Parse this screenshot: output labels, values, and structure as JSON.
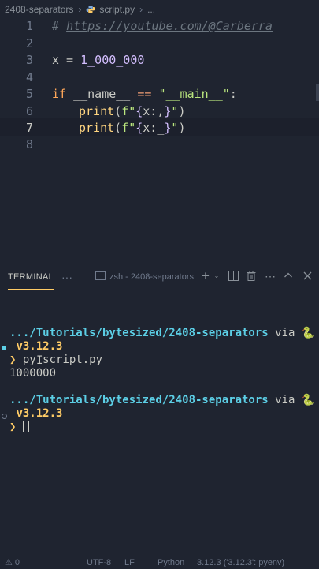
{
  "breadcrumb": {
    "folder": "2408-separators",
    "file": "script.py",
    "ellipsis": "..."
  },
  "editor": {
    "line_numbers": [
      "1",
      "2",
      "3",
      "4",
      "5",
      "6",
      "7",
      "8"
    ],
    "active_line": "7",
    "lines": {
      "l1": {
        "hash": "# ",
        "url": "https://youtube.com/@Carberra"
      },
      "l3": {
        "var": "x",
        "eq": " = ",
        "num": "1_000_000"
      },
      "l5": {
        "kw": "if",
        "name": " __name__ ",
        "op": "==",
        "str": " \"__main__\"",
        "colon": ":"
      },
      "l6": {
        "fn": "print",
        "open": "(",
        "fpre": "f\"",
        "lb": "{",
        "expr": "x:,",
        "rb": "}",
        "fpost": "\"",
        "close": ")"
      },
      "l7": {
        "fn": "print",
        "open": "(",
        "fpre": "f\"",
        "lb": "{",
        "expr": "x:_",
        "rb": "}",
        "fpost": "\"",
        "close": ")"
      }
    }
  },
  "panel": {
    "tab_terminal": "TERMINAL",
    "more": "···",
    "terminal_name": "zsh - 2408-separators"
  },
  "terminal": {
    "path1": ".../Tutorials/bytesized/2408-separators",
    "via1": " via ",
    "snake1": "🐍",
    "version1": "v3.12.3",
    "prompt1": "❯",
    "command1": " py script.py",
    "output1": "1000000",
    "path2": ".../Tutorials/bytesized/2408-separators",
    "via2": " via ",
    "snake2": "🐍",
    "version2": "v3.12.3",
    "prompt2": "❯"
  },
  "statusbar": {
    "problems": "⚠ 0",
    "encoding": "UTF-8",
    "eol": "LF",
    "language": "Python",
    "interpreter": "3.12.3 ('3.12.3': pyenv)"
  },
  "colors": {
    "background": "#1f2430",
    "accent": "#ffcc66",
    "path": "#5ccfe6"
  }
}
